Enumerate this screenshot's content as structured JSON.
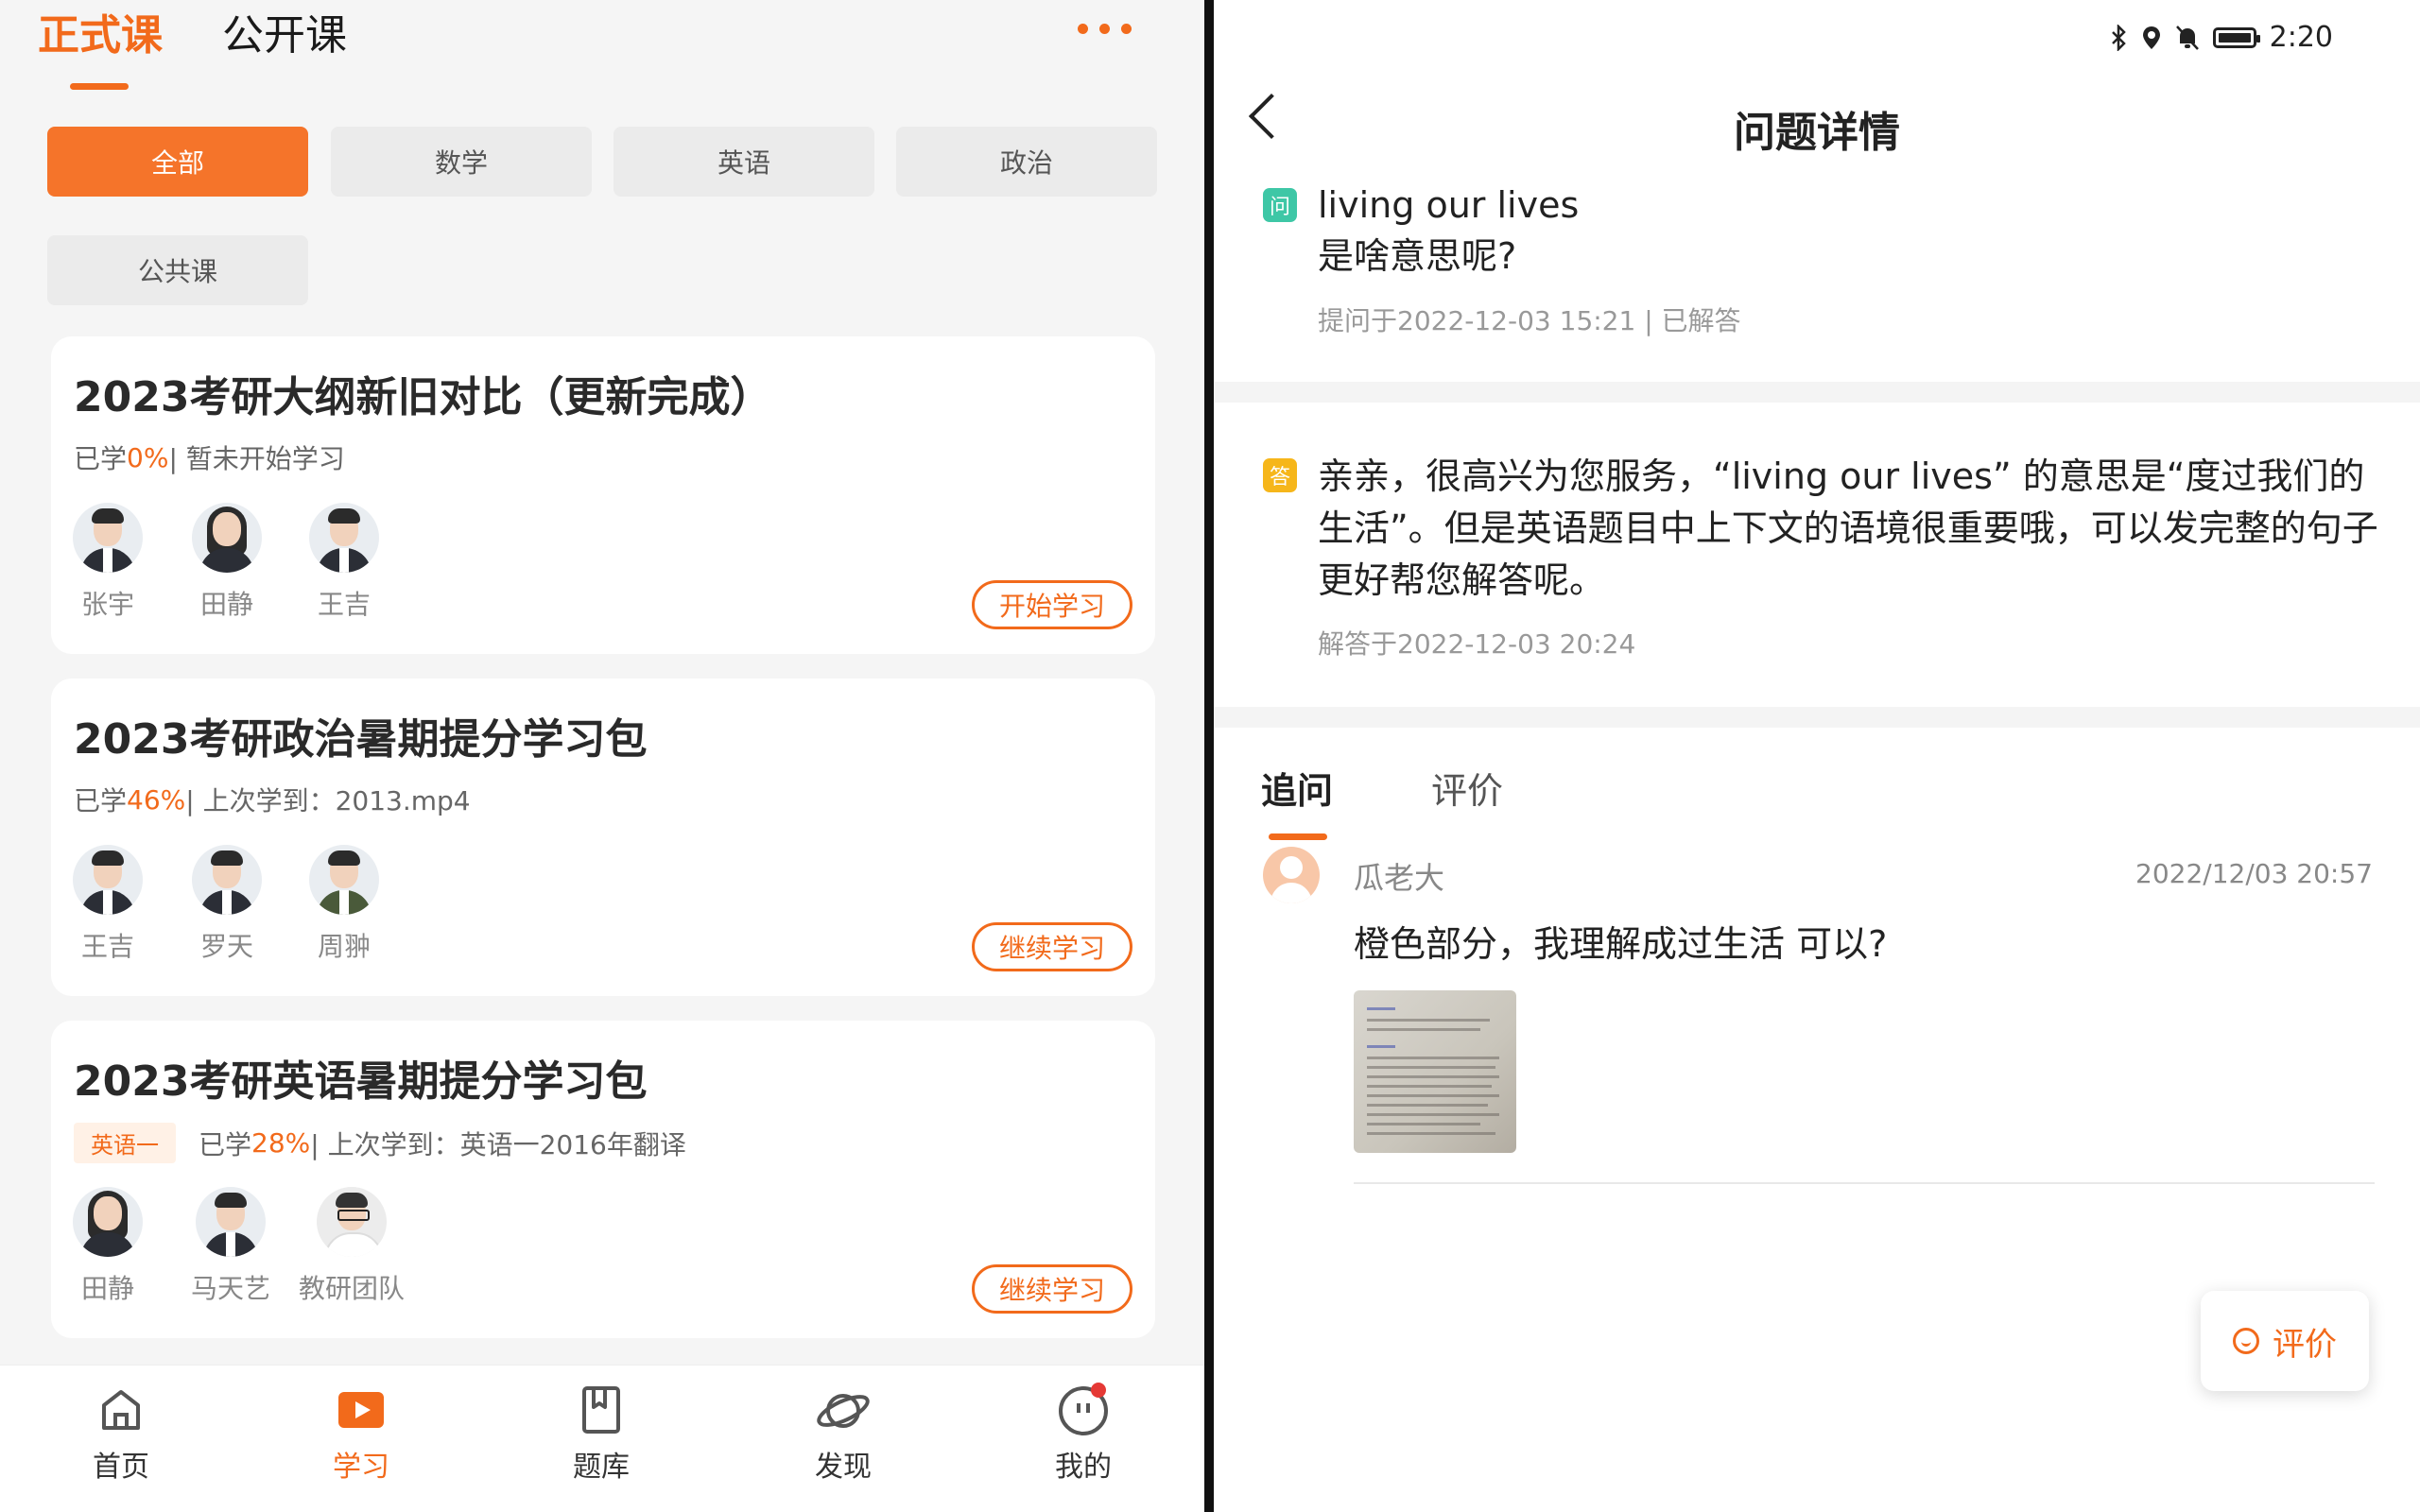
{
  "left": {
    "top_tabs": {
      "formal": "正式课",
      "public": "公开课"
    },
    "filters": [
      "全部",
      "数学",
      "英语",
      "政治",
      "公共课"
    ],
    "courses": [
      {
        "title": "2023考研大纲新旧对比（更新完成）",
        "progress_prefix": "已学",
        "progress_pct": "0%",
        "progress_suffix": " | 暂未开始学习",
        "tag": "",
        "teachers": [
          "张宇",
          "田静",
          "王吉"
        ],
        "button": "开始学习"
      },
      {
        "title": "2023考研政治暑期提分学习包",
        "progress_prefix": "已学",
        "progress_pct": "46%",
        "progress_suffix": " | 上次学到：2013.mp4",
        "tag": "",
        "teachers": [
          "王吉",
          "罗天",
          "周翀"
        ],
        "button": "继续学习"
      },
      {
        "title": "2023考研英语暑期提分学习包",
        "progress_prefix": "已学",
        "progress_pct": "28%",
        "progress_suffix": " | 上次学到：英语一2016年翻译",
        "tag": "英语一",
        "teachers": [
          "田静",
          "马天艺",
          "教研团队"
        ],
        "button": "继续学习"
      }
    ],
    "bottom_nav": [
      {
        "label": "首页",
        "icon": "home-icon"
      },
      {
        "label": "学习",
        "icon": "play-icon"
      },
      {
        "label": "题库",
        "icon": "book-icon"
      },
      {
        "label": "发现",
        "icon": "planet-icon"
      },
      {
        "label": "我的",
        "icon": "profile-icon"
      }
    ],
    "accent_color": "#f26a1b"
  },
  "right": {
    "status_bar": {
      "time": "2:20",
      "icons": [
        "bluetooth-icon",
        "location-icon",
        "mute-icon",
        "battery-icon"
      ]
    },
    "page_title": "问题详情",
    "question": {
      "badge": "问",
      "text_line1": "living our lives",
      "text_line2": "是啥意思呢?",
      "meta": "提问于2022-12-03 15:21 | 已解答"
    },
    "answer": {
      "badge": "答",
      "text": "亲亲，很高兴为您服务，“living our lives” 的意思是“度过我们的生活”。但是英语题目中上下文的语境很重要哦，可以发完整的句子更好帮您解答呢。",
      "meta": "解答于2022-12-03 20:24"
    },
    "sub_tabs": {
      "followup": "追问",
      "rate": "评价"
    },
    "followup": {
      "user": "瓜老大",
      "time": "2022/12/03 20:57",
      "text": "橙色部分，我理解成过生活  可以?"
    },
    "rate_button": "评价"
  }
}
